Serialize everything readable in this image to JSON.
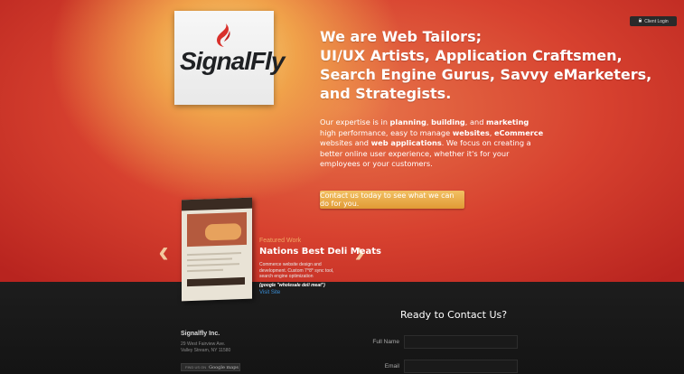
{
  "header": {
    "client_login": "Client Login"
  },
  "logo": {
    "text": "SignalFly"
  },
  "hero": {
    "headline": [
      "We are Web Tailors;",
      "UI/UX Artists, Application Craftsmen,",
      "Search Engine Gurus, Savvy eMarketers,",
      "and Strategists."
    ],
    "intro": {
      "p1": "Our expertise is in ",
      "b1": "planning",
      "p2": ", ",
      "b2": "building",
      "p3": ", and ",
      "b3": "marketing",
      "p4": " high performance, easy to manage ",
      "b4": "websites",
      "p5": ", ",
      "b5": "eCommerce",
      "p6": " websites and ",
      "b6": "web applications",
      "p7": ". We focus on creating a better online user experience, whether it's for your employees or your customers."
    },
    "cta": "Contact us today to see what we can do for you."
  },
  "featured": {
    "label": "Featured Work",
    "title": "Nations Best Deli Meats",
    "description": "Commerce website design and development. Custom 7^8* sync tool, search engine optimization",
    "query": "(google \"wholesale deli meat\")",
    "visit": "Visit Site",
    "prev_arrow": "‹",
    "next_arrow": "›"
  },
  "footer": {
    "company": "Signalfly Inc.",
    "address_line1": "29 West Fairview Ave.",
    "address_line2": "Valley Stream, NY 11580",
    "gmaps_prefix": "FIND US ON",
    "gmaps_brand": "Google maps"
  },
  "contact": {
    "title": "Ready to Contact Us?",
    "full_name_label": "Full Name",
    "full_name_value": "",
    "email_label": "Email",
    "email_value": ""
  },
  "colors": {
    "hero_red": "#d7412f",
    "cta_orange": "#e19a35",
    "footer_dark": "#1d1d1d",
    "link_blue": "#3a8fd8"
  }
}
